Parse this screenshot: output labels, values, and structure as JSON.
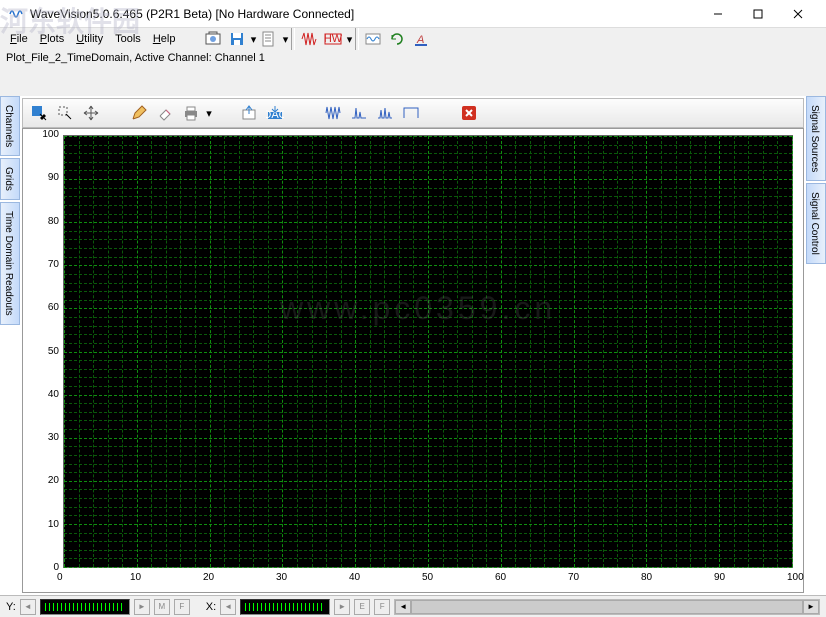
{
  "window": {
    "title": "WaveVision5.0.6.465 (P2R1 Beta)   [No Hardware Connected]"
  },
  "menu": {
    "file": "File",
    "plots": "Plots",
    "utility": "Utility",
    "tools": "Tools",
    "help": "Help"
  },
  "status": {
    "plot_info": "Plot_File_2_TimeDomain,  Active Channel: Channel 1"
  },
  "left_tabs": {
    "channels": "Channels",
    "grids": "Grids",
    "readouts": "Time Domain Readouts"
  },
  "right_tabs": {
    "sources": "Signal Sources",
    "control": "Signal Control"
  },
  "bottombar": {
    "y_label": "Y:",
    "x_label": "X:",
    "btn_m": "M",
    "btn_f": "F",
    "btn_e": "E"
  },
  "chart_data": {
    "type": "line",
    "title": "",
    "xlabel": "",
    "ylabel": "",
    "xlim": [
      0,
      100
    ],
    "ylim": [
      0,
      100
    ],
    "x_ticks": [
      0,
      10,
      20,
      30,
      40,
      50,
      60,
      70,
      80,
      90,
      100
    ],
    "y_ticks": [
      0,
      10,
      20,
      30,
      40,
      50,
      60,
      70,
      80,
      90,
      100
    ],
    "series": []
  },
  "watermark": {
    "main": "河东软件园",
    "sub": "www.pc0359.cn"
  }
}
